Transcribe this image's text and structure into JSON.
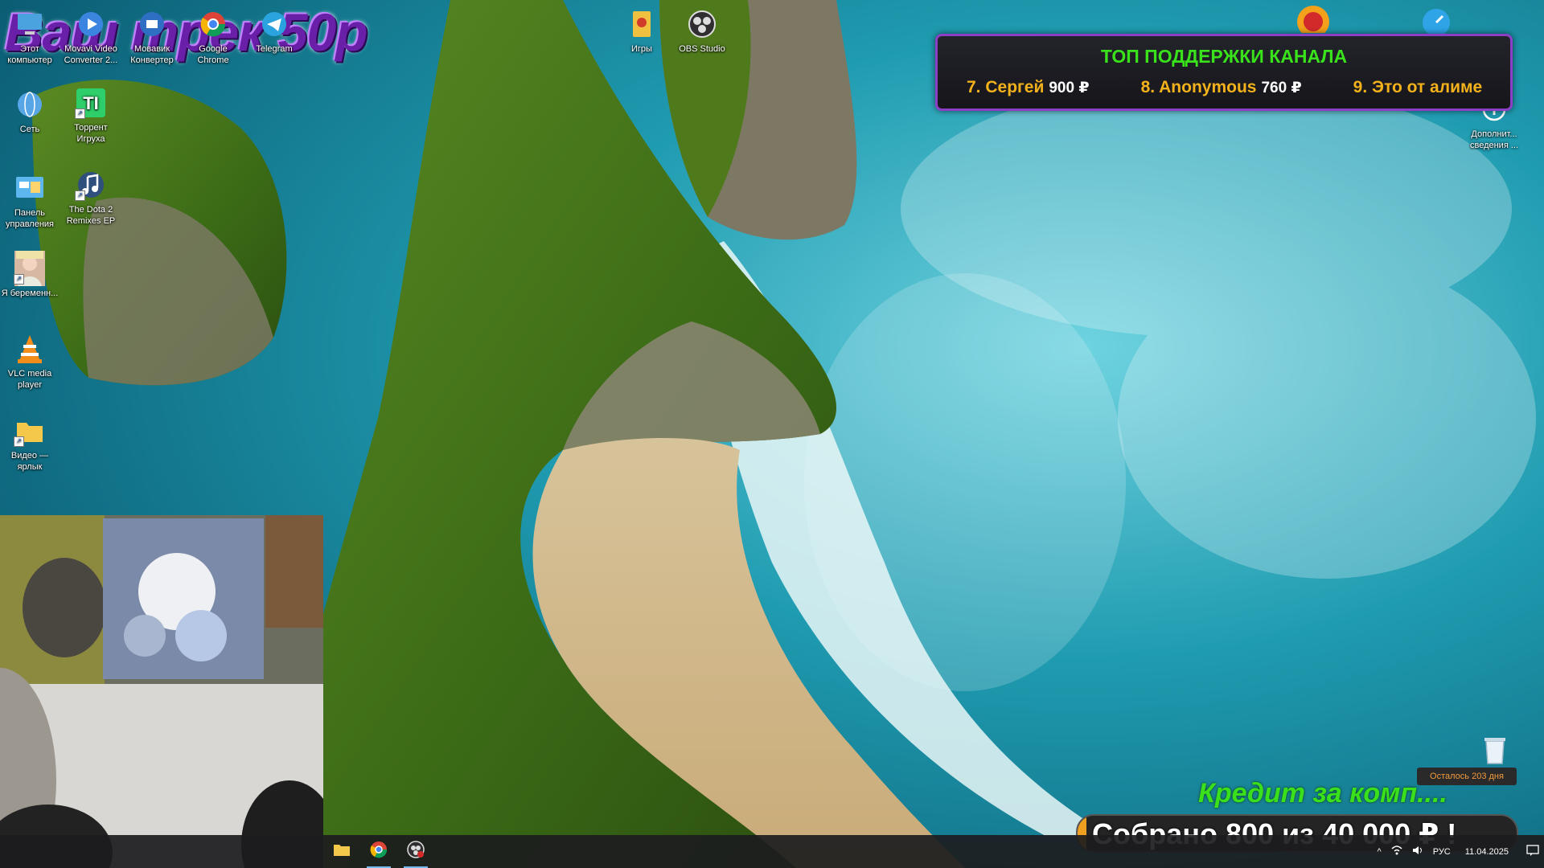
{
  "track_overlay": "Ваш трек 50р",
  "desktop_icons": {
    "top_row": [
      {
        "label": "Этот компьютер",
        "icon": "computer-icon"
      },
      {
        "label": "Movavi Video Converter 2...",
        "icon": "movavi-icon"
      },
      {
        "label": "Мовавик Конвертер",
        "icon": "movavi-converter-icon"
      },
      {
        "label": "Google Chrome",
        "icon": "chrome-icon"
      },
      {
        "label": "Telegram",
        "icon": "telegram-icon"
      },
      {
        "label": "Игры",
        "icon": "games-folder-icon"
      },
      {
        "label": "OBS Studio",
        "icon": "obs-icon"
      }
    ],
    "col1": [
      {
        "label": "Сеть",
        "icon": "network-icon"
      },
      {
        "label": "Панель управления",
        "icon": "control-panel-icon"
      },
      {
        "label": "Я беременн...",
        "icon": "image-shortcut-icon"
      },
      {
        "label": "VLC media player",
        "icon": "vlc-icon"
      },
      {
        "label": "Видео — ярлык",
        "icon": "folder-icon"
      }
    ],
    "col2": [
      {
        "label": "Торрент Игруха",
        "icon": "torrent-igruha-icon"
      },
      {
        "label": "The Dota 2 Remixes EP",
        "icon": "music-icon"
      }
    ],
    "right": [
      {
        "label": "Дополнит... сведения ...",
        "icon": "info-icon"
      }
    ]
  },
  "support_panel": {
    "title": "ТОП ПОДДЕРЖКИ КАНАЛА",
    "supporters": [
      {
        "name": "7. Сергей",
        "amount": "900 ₽"
      },
      {
        "name": "8. Anonymous",
        "amount": "760 ₽"
      },
      {
        "name": "9. Это от алиме",
        "amount": ""
      }
    ]
  },
  "goal": {
    "days_left": "Осталось 203 дня",
    "title": "Кредит за комп....",
    "collected_text": "Собрано 800  из 40 000 ₽ !",
    "progress_fraction": 0.02
  },
  "taskbar": {
    "apps": [
      {
        "name": "file-explorer",
        "icon": "folder-icon"
      },
      {
        "name": "chrome",
        "icon": "chrome-icon"
      },
      {
        "name": "obs",
        "icon": "obs-icon"
      }
    ],
    "tray": {
      "language": "РУС",
      "date": "11.04.2025"
    }
  },
  "colors": {
    "support_border": "#8c3ec4",
    "support_title": "#39e21b",
    "supporter_name": "#f3b21b",
    "goal_title": "#3be01c",
    "goal_fill": "#f0a020",
    "track_overlay": "#6a1fa8"
  }
}
